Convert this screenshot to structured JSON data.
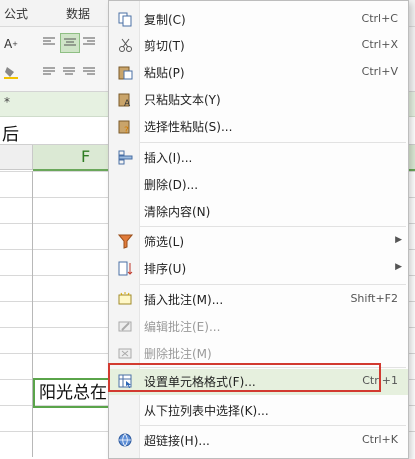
{
  "menubar": {
    "tab1": "公式",
    "tab2": "数据"
  },
  "ribbon": {
    "font_grow": "A",
    "font_shrink": "A"
  },
  "formula_bar": {
    "marker": "*"
  },
  "cell_preview": {
    "text": "后"
  },
  "columns": {
    "f": "F"
  },
  "cell": {
    "text": "阳光总在"
  },
  "context_menu": {
    "items": [
      {
        "label": "复制(C)",
        "shortcut": "Ctrl+C",
        "icon": "copy-icon"
      },
      {
        "label": "剪切(T)",
        "shortcut": "Ctrl+X",
        "icon": "cut-icon"
      },
      {
        "label": "粘贴(P)",
        "shortcut": "Ctrl+V",
        "icon": "paste-icon"
      },
      {
        "label": "只粘贴文本(Y)",
        "shortcut": "",
        "icon": "paste-text-icon"
      },
      {
        "label": "选择性粘贴(S)...",
        "shortcut": "",
        "icon": "paste-special-icon"
      },
      {
        "label": "插入(I)...",
        "shortcut": "",
        "icon": "insert-icon"
      },
      {
        "label": "删除(D)...",
        "shortcut": "",
        "icon": ""
      },
      {
        "label": "清除内容(N)",
        "shortcut": "",
        "icon": ""
      },
      {
        "label": "筛选(L)",
        "shortcut": "",
        "icon": "filter-icon",
        "submenu": true
      },
      {
        "label": "排序(U)",
        "shortcut": "",
        "icon": "sort-icon",
        "submenu": true
      },
      {
        "label": "插入批注(M)...",
        "shortcut": "Shift+F2",
        "icon": "insert-comment-icon"
      },
      {
        "label": "编辑批注(E)...",
        "shortcut": "",
        "icon": "edit-comment-icon",
        "disabled": true
      },
      {
        "label": "删除批注(M)",
        "shortcut": "",
        "icon": "delete-comment-icon",
        "disabled": true
      },
      {
        "label": "设置单元格格式(F)...",
        "shortcut": "Ctrl+1",
        "icon": "format-cells-icon",
        "highlighted": true
      },
      {
        "label": "从下拉列表中选择(K)...",
        "shortcut": "",
        "icon": ""
      },
      {
        "label": "超链接(H)...",
        "shortcut": "Ctrl+K",
        "icon": "hyperlink-icon"
      }
    ]
  },
  "colors": {
    "highlight": "#e6f0de",
    "red_annotation": "#d23a30",
    "green_accent": "#5aa44a"
  }
}
